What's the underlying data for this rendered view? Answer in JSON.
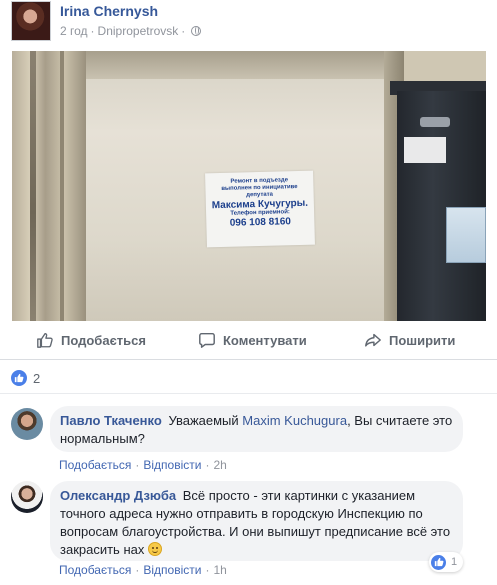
{
  "post": {
    "author": "Irina Chernysh",
    "time": "2 год",
    "separator": "·",
    "location": "Dnipropetrovsk",
    "privacy_icon": "globe-icon"
  },
  "photo": {
    "notice_lines": [
      "Ремонт в подъезде",
      "выполнен по инициативе",
      "депутата",
      "Максима Кучугуры.",
      "Телефон приемной:",
      "096 108 8160"
    ]
  },
  "actions": {
    "like": "Подобається",
    "comment": "Коментувати",
    "share": "Поширити"
  },
  "reactions": {
    "count": "2",
    "icon": "like-icon"
  },
  "comments": [
    {
      "author": "Павло Ткаченко",
      "text_before": "Уважаемый",
      "mention": "Maxim Kuchugura",
      "text_after": ", Вы считаете это нормальным?",
      "like_label": "Подобається",
      "reply_label": "Відповісти",
      "sep": "·",
      "time": "2h"
    },
    {
      "author": "Олександр Дзюба",
      "text": "Всё просто - эти картинки с указанием точного адреса нужно отправить в городскую Инспекцию по вопросам благоустройства. И они выпишут предписание всё это закрасить нах",
      "emoji": "smiley-icon",
      "like_label": "Подобається",
      "reply_label": "Відповісти",
      "sep": "·",
      "time": "1h",
      "reaction_count": "1"
    }
  ],
  "colors": {
    "link": "#365899",
    "meta": "#90949c",
    "like_blue": "#4a7fe8",
    "bubble": "#f2f3f5"
  }
}
